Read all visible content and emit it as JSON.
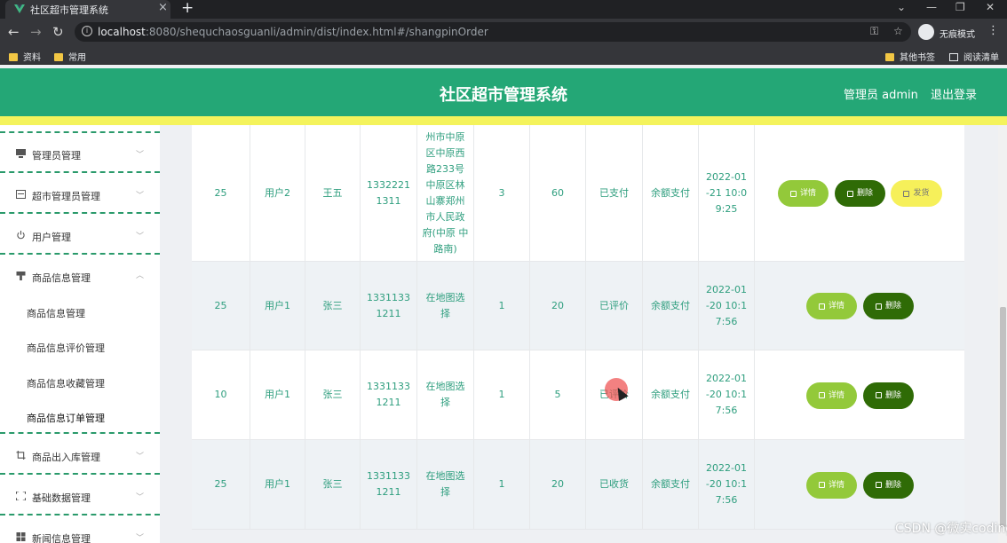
{
  "browser": {
    "tab_title": "社区超市管理系统",
    "url_host": "localhost",
    "url_rest": ":8080/shequchaosguanli/admin/dist/index.html#/shangpinOrder",
    "profile_label": "无痕模式",
    "bookmarks": [
      "资料",
      "常用"
    ],
    "bookmarks_right": [
      "其他书签",
      "阅读清单"
    ]
  },
  "header": {
    "title": "社区超市管理系统",
    "user": "管理员 admin",
    "logout": "退出登录"
  },
  "sidebar": {
    "items": [
      {
        "label": "管理员管理",
        "icon": "monitor-icon"
      },
      {
        "label": "超市管理员管理",
        "icon": "card-icon"
      },
      {
        "label": "用户管理",
        "icon": "power-icon"
      },
      {
        "label": "商品信息管理",
        "icon": "stamp-icon"
      },
      {
        "label": "商品出入库管理",
        "icon": "crop-icon"
      },
      {
        "label": "基础数据管理",
        "icon": "fullscreen-icon"
      },
      {
        "label": "新闻信息管理",
        "icon": "grid-icon"
      }
    ],
    "sub_items": [
      "商品信息管理",
      "商品信息评价管理",
      "商品信息收藏管理",
      "商品信息订单管理"
    ]
  },
  "buttons": {
    "detail": "详情",
    "delete": "删除",
    "ship": "发货"
  },
  "table": {
    "rows": [
      {
        "c0": "25",
        "c1": "用户2",
        "c2": "王五",
        "c3": "1332221 1311",
        "c4": "州市中原 区中原西 路233号 中原区林 山寨郑州 市人民政 府(中原 中路南)",
        "c5": "3",
        "c6": "60",
        "c7": "已支付",
        "c8": "余额支付",
        "c9": "2022-01 -21 10:0 9:25",
        "ship": true
      },
      {
        "c0": "25",
        "c1": "用户1",
        "c2": "张三",
        "c3": "1331133 1211",
        "c4": "在地图选 择",
        "c5": "1",
        "c6": "20",
        "c7": "已评价",
        "c8": "余额支付",
        "c9": "2022-01 -20 10:1 7:56",
        "ship": false
      },
      {
        "c0": "10",
        "c1": "用户1",
        "c2": "张三",
        "c3": "1331133 1211",
        "c4": "在地图选 择",
        "c5": "1",
        "c6": "5",
        "c7": "已评价",
        "c8": "余额支付",
        "c9": "2022-01 -20 10:1 7:56",
        "ship": false
      },
      {
        "c0": "25",
        "c1": "用户1",
        "c2": "张三",
        "c3": "1331133 1211",
        "c4": "在地图选 择",
        "c5": "1",
        "c6": "20",
        "c7": "已收货",
        "c8": "余额支付",
        "c9": "2022-01 -20 10:1 7:56",
        "ship": false
      }
    ]
  },
  "watermark": "CSDN @微实coding",
  "colors": {
    "header": "#24a776",
    "stripe": "#f4f35c",
    "detail": "#93c93a",
    "delete": "#2f6b06",
    "ship": "#f6f05a",
    "cell_text": "#2e9e7e"
  }
}
